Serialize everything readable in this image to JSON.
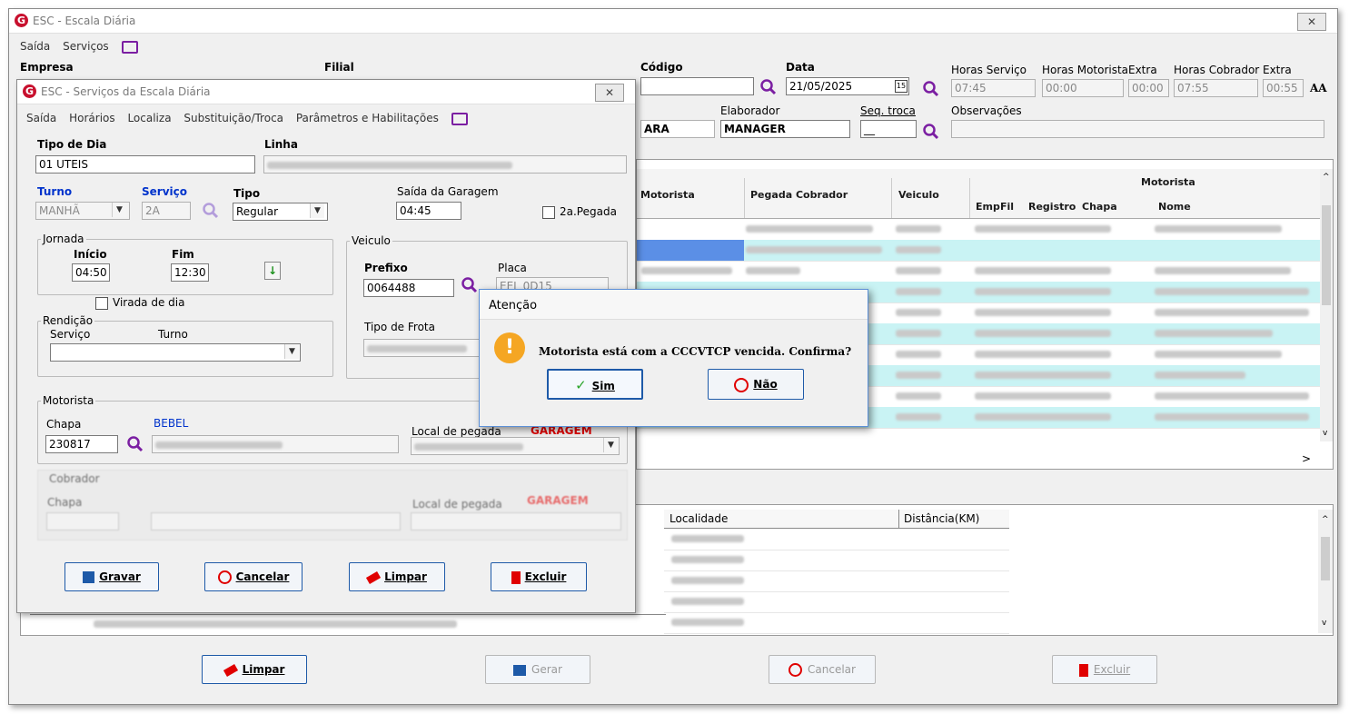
{
  "main_window": {
    "title": "ESC - Escala Diária",
    "menu": [
      "Saída",
      "Serviços"
    ],
    "fields": {
      "empresa_label": "Empresa",
      "filial_label": "Filial",
      "codigo_label": "Código",
      "data_label": "Data",
      "data_value": "21/05/2025",
      "horas_servico_label": "Horas Serviço",
      "horas_servico_value": "07:45",
      "horas_motorista_label": "Horas Motorista",
      "horas_motorista_value": "00:00",
      "extra1_label": "Extra",
      "extra1_value": "00:00",
      "horas_cobrador_label": "Horas Cobrador",
      "horas_cobrador_value": "07:55",
      "extra2_label": "Extra",
      "extra2_value": "00:55",
      "ara_value": "ARA",
      "elaborador_label": "Elaborador",
      "elaborador_value": "MANAGER",
      "seq_troca_label": "Seq. troca",
      "seq_troca_value": "__",
      "observacoes_label": "Observações",
      "font_toggle": "AA"
    },
    "grid": {
      "cols": [
        "Motorista",
        "Pegada Cobrador",
        "Veiculo"
      ],
      "group_header": "Motorista",
      "sub_cols": [
        "Emp",
        "Fil",
        "Registro",
        "Chapa",
        "Nome"
      ],
      "scroll_right": ">"
    },
    "bottom_grid": {
      "cols": [
        "Localidade",
        "Distância(KM)"
      ]
    },
    "footer_buttons": {
      "limpar": "Limpar",
      "gerar": "Gerar",
      "cancelar": "Cancelar",
      "excluir": "Excluir"
    }
  },
  "services_window": {
    "title": "ESC - Serviços da Escala Diária",
    "menu": [
      "Saída",
      "Horários",
      "Localiza",
      "Substituição/Troca",
      "Parâmetros e Habilitações"
    ],
    "tipo_dia_label": "Tipo de Dia",
    "tipo_dia_value": "01 UTEIS",
    "linha_label": "Linha",
    "turno_label": "Turno",
    "turno_value": "MANHÃ",
    "servico_label": "Serviço",
    "servico_value": "2A",
    "tipo_label": "Tipo",
    "tipo_value": "Regular",
    "saida_garagem_label": "Saída da Garagem",
    "saida_garagem_value": "04:45",
    "pegada2_label": "2a.Pegada",
    "jornada_label": "Jornada",
    "inicio_label": "Início",
    "inicio_value": "04:50",
    "fim_label": "Fim",
    "fim_value": "12:30",
    "virada_label": "Virada de dia",
    "rendicao_label": "Rendição",
    "rend_servico_label": "Serviço",
    "rend_turno_label": "Turno",
    "veiculo_label": "Veiculo",
    "prefixo_label": "Prefixo",
    "prefixo_value": "0064488",
    "placa_label": "Placa",
    "placa_value": "EEL 0D15",
    "tipo_frota_label": "Tipo de Frota",
    "motorista_label": "Motorista",
    "chapa_label": "Chapa",
    "chapa_value": "230817",
    "apelido": "BEBEL",
    "local_pegada_label": "Local de pegada",
    "garagem_label": "GARAGEM",
    "cobrador_label": "Cobrador",
    "cob_chapa_label": "Chapa",
    "cob_local_label": "Local de pegada",
    "cob_garagem_label": "GARAGEM",
    "buttons": {
      "gravar": "Gravar",
      "cancelar": "Cancelar",
      "limpar": "Limpar",
      "excluir": "Excluir"
    }
  },
  "dialog": {
    "title": "Atenção",
    "message": "Motorista está com a CCCVTCP vencida. Confirma?",
    "yes": "Sim",
    "no": "Não"
  },
  "colors": {
    "accent_blue": "#1e5aa8",
    "row_highlight": "#c9f3f4",
    "warning": "#f5a623",
    "danger": "#e00000"
  }
}
